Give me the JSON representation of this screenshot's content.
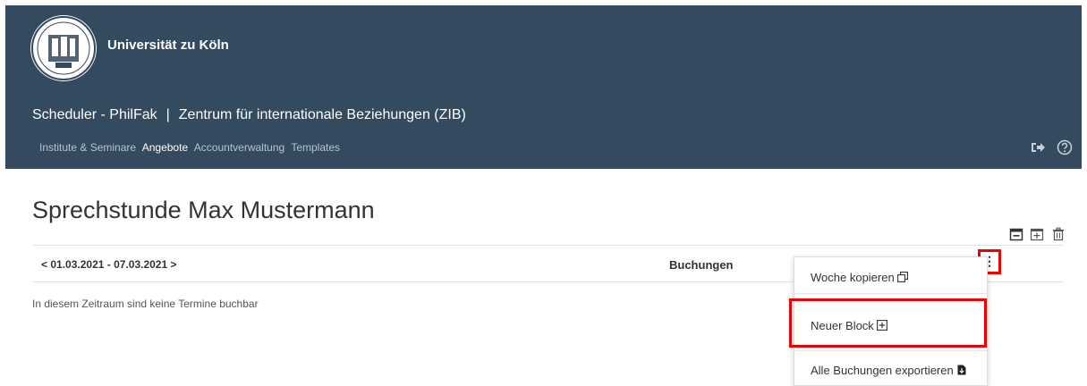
{
  "header": {
    "university": "Universität zu Köln",
    "app_name": "Scheduler - PhilFak",
    "separator": "|",
    "department": "Zentrum für internationale Beziehungen (ZIB)",
    "nav": [
      {
        "label": "Institute & Seminare",
        "active": false
      },
      {
        "label": "Angebote",
        "active": true
      },
      {
        "label": "Accountverwaltung",
        "active": false
      },
      {
        "label": "Templates",
        "active": false
      }
    ],
    "icons": [
      "logout-icon",
      "help-icon"
    ]
  },
  "page": {
    "title": "Sprechstunde Max Mustermann",
    "actions": [
      "calendar-minus-icon",
      "calendar-plus-icon",
      "trash-icon"
    ]
  },
  "week": {
    "range": "01.03.2021 - 07.03.2021",
    "prev_symbol": "<",
    "next_symbol": ">",
    "bookings_header": "Buchungen",
    "menu_symbol": "⋮",
    "empty_message": "In diesem Zeitraum sind keine Termine buchbar"
  },
  "menu": {
    "items": [
      {
        "label": "Woche kopieren",
        "icon": "copy-icon"
      },
      {
        "label": "Neuer Block",
        "icon": "plus-square-icon"
      },
      {
        "label": "Alle Buchungen exportieren",
        "icon": "file-export-icon"
      }
    ]
  },
  "colors": {
    "header_bg": "#344a5e",
    "highlight": "#e00000"
  }
}
